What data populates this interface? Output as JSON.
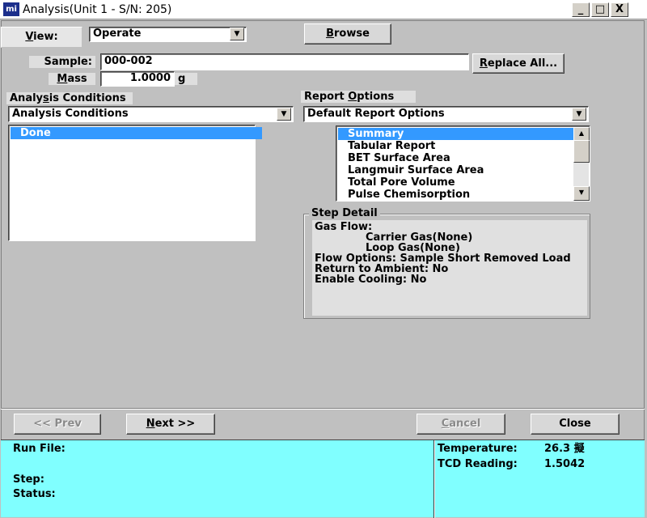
{
  "window": {
    "icon_text": "mi",
    "title": "Analysis(Unit 1 - S/N: 205)",
    "controls": {
      "minimize": "_",
      "maximize": "□",
      "close": "X"
    }
  },
  "view": {
    "label_prefix": "V",
    "label_rest": "iew:",
    "selected": "Operate",
    "browse_prefix": "B",
    "browse_rest": "rowse"
  },
  "sample": {
    "label": "Sample:",
    "value": "000-002",
    "replace_all_prefix": "R",
    "replace_all_rest": "eplace All..."
  },
  "mass": {
    "label_prefix": "M",
    "label_rest": "ass",
    "value": "1.0000",
    "unit": "g"
  },
  "analysis_conditions": {
    "label_prefix": "Analy",
    "label_u": "s",
    "label_rest": "is Conditions",
    "selected": "Analysis Conditions",
    "steps": [
      "Done"
    ]
  },
  "report_options": {
    "label_prefix": "Report ",
    "label_u": "O",
    "label_rest": "ptions",
    "selected": "Default Report Options",
    "items": [
      "Summary",
      "Tabular Report",
      "BET Surface Area",
      "Langmuir Surface Area",
      "Total Pore Volume",
      "Pulse Chemisorption"
    ]
  },
  "step_detail": {
    "title": "Step Detail",
    "lines": [
      "Gas Flow:",
      "Carrier Gas(None)",
      "Loop Gas(None)",
      "Flow Options:  Sample Short Removed Load",
      "Return to Ambient: No",
      "Enable Cooling: No"
    ]
  },
  "nav": {
    "prev": "<< Prev",
    "next_prefix": "N",
    "next_rest": "ext >>",
    "cancel_prefix": "C",
    "cancel_rest": "ancel",
    "close": "Close"
  },
  "status": {
    "run_file_label": "Run File:",
    "step_label": "Step:",
    "status_label": "Status:",
    "temperature_label": "Temperature:",
    "temperature_value": "26.3 擬",
    "tcd_label": "TCD Reading:",
    "tcd_value": "1.5042",
    "background_color": "#80ffff"
  },
  "colors": {
    "selection": "#3399ff",
    "window_bg": "#c0c0c0"
  }
}
